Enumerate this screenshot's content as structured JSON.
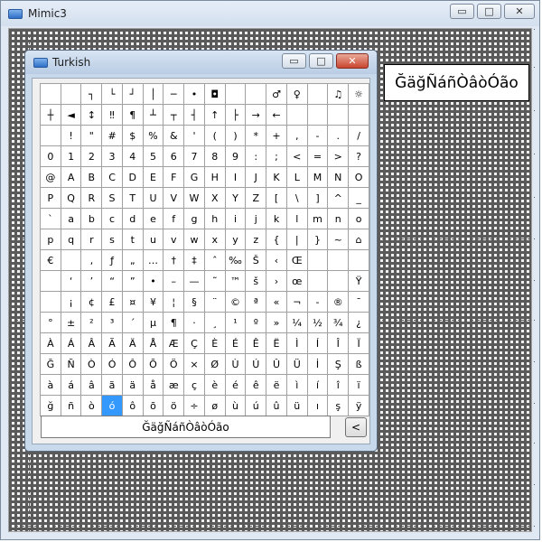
{
  "main_window": {
    "title": "Mimic3",
    "minimize_glyph": "▭",
    "maximize_glyph": "□",
    "close_glyph": "✕"
  },
  "preview_text": "ĞäğÑáñÒâòÓão",
  "keyboard_window": {
    "title": "Turkish",
    "minimize_glyph": "▭",
    "maximize_glyph": "□",
    "close_glyph": "✕",
    "input_value": "ĞäğÑáñÒâòÓão",
    "backspace_label": "<",
    "selected_char": "ó",
    "rows": [
      [
        "",
        "",
        "┐",
        "└",
        "┘",
        "│",
        "─",
        "•",
        "◘",
        "",
        "",
        "♂",
        "♀",
        "",
        "♫",
        "☼"
      ],
      [
        "┼",
        "◄",
        "↕",
        "‼",
        "¶",
        "┴",
        "┬",
        "┤",
        "↑",
        "├",
        "→",
        "←",
        "",
        "",
        "",
        ""
      ],
      [
        "",
        "!",
        "\"",
        "#",
        "$",
        "%",
        "&",
        "'",
        "(",
        ")",
        "*",
        "+",
        ",",
        "-",
        ".",
        "/"
      ],
      [
        "0",
        "1",
        "2",
        "3",
        "4",
        "5",
        "6",
        "7",
        "8",
        "9",
        ":",
        ";",
        "<",
        "=",
        ">",
        "?"
      ],
      [
        "@",
        "A",
        "B",
        "C",
        "D",
        "E",
        "F",
        "G",
        "H",
        "I",
        "J",
        "K",
        "L",
        "M",
        "N",
        "O"
      ],
      [
        "P",
        "Q",
        "R",
        "S",
        "T",
        "U",
        "V",
        "W",
        "X",
        "Y",
        "Z",
        "[",
        "\\",
        "]",
        "^",
        "_"
      ],
      [
        "`",
        "a",
        "b",
        "c",
        "d",
        "e",
        "f",
        "g",
        "h",
        "i",
        "j",
        "k",
        "l",
        "m",
        "n",
        "o"
      ],
      [
        "p",
        "q",
        "r",
        "s",
        "t",
        "u",
        "v",
        "w",
        "x",
        "y",
        "z",
        "{",
        "|",
        "}",
        "~",
        "⌂"
      ],
      [
        "€",
        "",
        "‚",
        "ƒ",
        "„",
        "…",
        "†",
        "‡",
        "ˆ",
        "‰",
        "Š",
        "‹",
        "Œ",
        "",
        "",
        ""
      ],
      [
        "",
        "‘",
        "’",
        "“",
        "”",
        "•",
        "–",
        "—",
        "˜",
        "™",
        "š",
        "›",
        "œ",
        "",
        "",
        "Ÿ"
      ],
      [
        "",
        "¡",
        "¢",
        "£",
        "¤",
        "¥",
        "¦",
        "§",
        "¨",
        "©",
        "ª",
        "«",
        "¬",
        "-",
        "®",
        "¯"
      ],
      [
        "°",
        "±",
        "²",
        "³",
        "´",
        "µ",
        "¶",
        "·",
        "¸",
        "¹",
        "º",
        "»",
        "¼",
        "½",
        "¾",
        "¿"
      ],
      [
        "À",
        "Á",
        "Â",
        "Ã",
        "Ä",
        "Å",
        "Æ",
        "Ç",
        "È",
        "É",
        "Ê",
        "Ë",
        "Ì",
        "Í",
        "Î",
        "Ï"
      ],
      [
        "Ğ",
        "Ñ",
        "Ò",
        "Ó",
        "Ô",
        "Õ",
        "Ö",
        "×",
        "Ø",
        "Ù",
        "Ú",
        "Û",
        "Ü",
        "İ",
        "Ş",
        "ß"
      ],
      [
        "à",
        "á",
        "â",
        "ã",
        "ä",
        "å",
        "æ",
        "ç",
        "è",
        "é",
        "ê",
        "ë",
        "ì",
        "í",
        "î",
        "ï"
      ],
      [
        "ğ",
        "ñ",
        "ò",
        "ó",
        "ô",
        "õ",
        "ö",
        "÷",
        "ø",
        "ù",
        "ú",
        "û",
        "ü",
        "ı",
        "ş",
        "ÿ"
      ]
    ]
  },
  "colors": {
    "selection": "#3399ff",
    "grid_line": "#5a5a5a"
  }
}
